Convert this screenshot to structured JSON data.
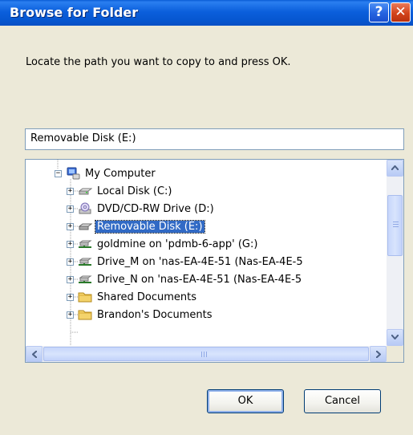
{
  "window": {
    "title": "Browse for Folder",
    "help_glyph": "?",
    "close_glyph": "✕"
  },
  "prompt": "Locate the path you want to copy to and press OK.",
  "path_value": "Removable Disk (E:)",
  "tree": {
    "nodes": [
      {
        "label": "My Computer",
        "expander": "−",
        "icon": "computer-icon"
      },
      {
        "label": "Local Disk (C:)",
        "expander": "+",
        "icon": "hard-drive-icon"
      },
      {
        "label": "DVD/CD-RW Drive (D:)",
        "expander": "+",
        "icon": "dvd-drive-icon"
      },
      {
        "label": "Removable Disk (E:)",
        "expander": "+",
        "icon": "removable-disk-icon",
        "selected": true
      },
      {
        "label": "goldmine on 'pdmb-6-app' (G:)",
        "expander": "+",
        "icon": "network-drive-icon"
      },
      {
        "label": "Drive_M on 'nas-EA-4E-51 (Nas-EA-4E-5",
        "expander": "+",
        "icon": "network-drive-icon"
      },
      {
        "label": "Drive_N on 'nas-EA-4E-51 (Nas-EA-4E-5",
        "expander": "+",
        "icon": "network-drive-icon"
      },
      {
        "label": "Shared Documents",
        "expander": "+",
        "icon": "folder-icon"
      },
      {
        "label": "Brandon's Documents",
        "expander": "+",
        "icon": "folder-icon"
      }
    ]
  },
  "buttons": {
    "ok": "OK",
    "cancel": "Cancel"
  },
  "colors": {
    "titlebar": "#0b5fdc",
    "selection": "#316ac5",
    "dialog_bg": "#ece9d8"
  }
}
